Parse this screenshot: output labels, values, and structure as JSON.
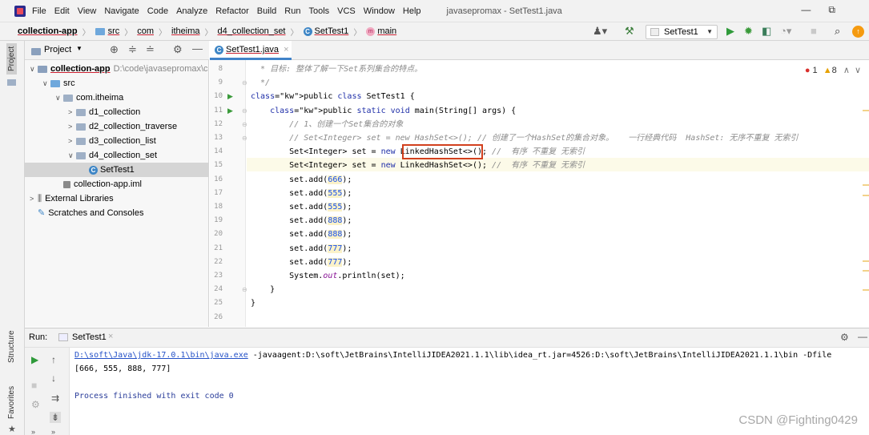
{
  "menu": {
    "items": [
      "File",
      "Edit",
      "View",
      "Navigate",
      "Code",
      "Analyze",
      "Refactor",
      "Build",
      "Run",
      "Tools",
      "VCS",
      "Window",
      "Help"
    ],
    "window_title": "javasepromax - SetTest1.java",
    "window_controls": [
      "—",
      "⧉"
    ]
  },
  "breadcrumb": {
    "items": [
      "collection-app",
      "src",
      "com",
      "itheima",
      "d4_collection_set",
      "SetTest1",
      "main"
    ]
  },
  "toolbar": {
    "run_config": "SetTest1",
    "icons": [
      "user-icon",
      "hammer-icon",
      "run-icon",
      "debug-icon",
      "coverage-icon",
      "profile-icon",
      "stop-icon",
      "search-icon",
      "update-icon"
    ]
  },
  "left_strip": {
    "project_label": "Project",
    "structure_label": "Structure",
    "favorites_label": "Favorites"
  },
  "project": {
    "header_label": "Project",
    "tree": [
      {
        "label": "collection-app",
        "extra": "D:\\code\\javasepromax\\c",
        "indent": 0,
        "arrow": "∨",
        "icon": "project-folder"
      },
      {
        "label": "src",
        "indent": 1,
        "arrow": "∨",
        "icon": "src-folder"
      },
      {
        "label": "com.itheima",
        "indent": 2,
        "arrow": "∨",
        "icon": "package"
      },
      {
        "label": "d1_collection",
        "indent": 3,
        "arrow": ">",
        "icon": "package"
      },
      {
        "label": "d2_collection_traverse",
        "indent": 3,
        "arrow": ">",
        "icon": "package"
      },
      {
        "label": "d3_collection_list",
        "indent": 3,
        "arrow": ">",
        "icon": "package"
      },
      {
        "label": "d4_collection_set",
        "indent": 3,
        "arrow": "∨",
        "icon": "package"
      },
      {
        "label": "SetTest1",
        "indent": 4,
        "arrow": "",
        "icon": "class",
        "selected": true
      },
      {
        "label": "collection-app.iml",
        "indent": 2,
        "arrow": "",
        "icon": "iml"
      },
      {
        "label": "External Libraries",
        "indent": 0,
        "arrow": ">",
        "icon": "libraries"
      },
      {
        "label": "Scratches and Consoles",
        "indent": 0,
        "arrow": "",
        "icon": "scratches"
      }
    ]
  },
  "editor": {
    "tab_label": "SetTest1.java",
    "inspection": {
      "errors": "1",
      "warnings": "8"
    },
    "line_numbers": [
      "8",
      "9",
      "10",
      "11",
      "12",
      "13",
      "14",
      "15",
      "16",
      "17",
      "18",
      "19",
      "20",
      "21",
      "22",
      "23",
      "24",
      "25",
      "26"
    ],
    "lines": [
      "  * 目标: 整体了解一下Set系列集合的特点。",
      "  */",
      "public class SetTest1 {",
      "    public static void main(String[] args) {",
      "        // 1、创建一个Set集合的对象",
      "        // Set<Integer> set = new HashSet<>(); // 创建了一个HashSet的集合对象。   一行经典代码  HashSet: 无序不重复 无索引",
      "        Set<Integer> set = new LinkedHashSet<>(); //  有序 不重复 无索引",
      "        Set<Integer> set = new LinkedHashSet<>(); //  有序 不重复 无索引",
      "        set.add(666);",
      "        set.add(555);",
      "        set.add(555);",
      "        set.add(888);",
      "        set.add(888);",
      "        set.add(777);",
      "        set.add(777);",
      "        System.out.println(set);",
      "    }",
      "}",
      ""
    ]
  },
  "run": {
    "label": "Run:",
    "tab": "SetTest1",
    "cmd_path": "D:\\soft\\Java\\jdk-17.0.1\\bin\\java.exe",
    "cmd_rest": " -javaagent:D:\\soft\\JetBrains\\IntelliJIDEA2021.1.1\\lib\\idea_rt.jar=4526:D:\\soft\\JetBrains\\IntelliJIDEA2021.1.1\\bin -Dfile",
    "output": "[666, 555, 888, 777]",
    "exit": "Process finished with exit code 0"
  },
  "watermark": "CSDN @Fighting0429",
  "colors": {
    "accent": "#4083c9",
    "highlight_box": "#d2401e",
    "keyword": "#1f2fa8",
    "comment": "#8c8c8c",
    "number": "#1750eb"
  }
}
